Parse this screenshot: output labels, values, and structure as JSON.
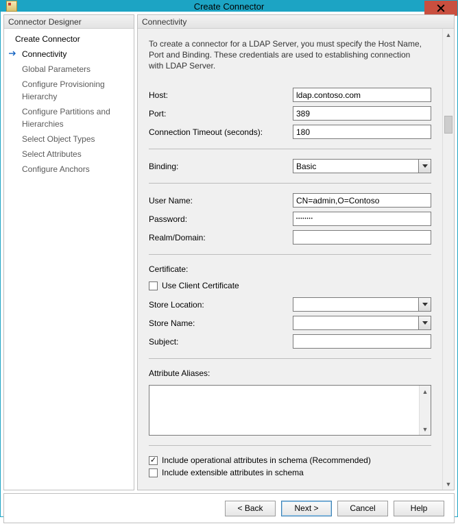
{
  "window": {
    "title": "Create Connector"
  },
  "left": {
    "header": "Connector Designer",
    "items": [
      {
        "label": "Create Connector"
      },
      {
        "label": "Connectivity"
      },
      {
        "label": "Global Parameters"
      },
      {
        "label": "Configure Provisioning Hierarchy"
      },
      {
        "label": "Configure Partitions and Hierarchies"
      },
      {
        "label": "Select Object Types"
      },
      {
        "label": "Select Attributes"
      },
      {
        "label": "Configure Anchors"
      }
    ]
  },
  "right": {
    "header": "Connectivity",
    "intro": "To create a connector for a LDAP Server, you must specify the Host Name, Port and Binding. These credentials are used to establishing connection with LDAP Server.",
    "host_label": "Host:",
    "host_value": "ldap.contoso.com",
    "port_label": "Port:",
    "port_value": "389",
    "timeout_label": "Connection Timeout (seconds):",
    "timeout_value": "180",
    "binding_label": "Binding:",
    "binding_value": "Basic",
    "user_label": "User Name:",
    "user_value": "CN=admin,O=Contoso",
    "password_label": "Password:",
    "password_value": "••••••••",
    "realm_label": "Realm/Domain:",
    "realm_value": "",
    "cert_label": "Certificate:",
    "use_client_cert_label": "Use Client Certificate",
    "store_location_label": "Store Location:",
    "store_location_value": "",
    "store_name_label": "Store Name:",
    "store_name_value": "",
    "subject_label": "Subject:",
    "subject_value": "",
    "aliases_label": "Attribute Aliases:",
    "include_op_label": "Include operational attributes in schema (Recommended)",
    "include_ext_label": "Include extensible attributes in schema"
  },
  "footer": {
    "back": "<  Back",
    "next": "Next  >",
    "cancel": "Cancel",
    "help": "Help"
  }
}
